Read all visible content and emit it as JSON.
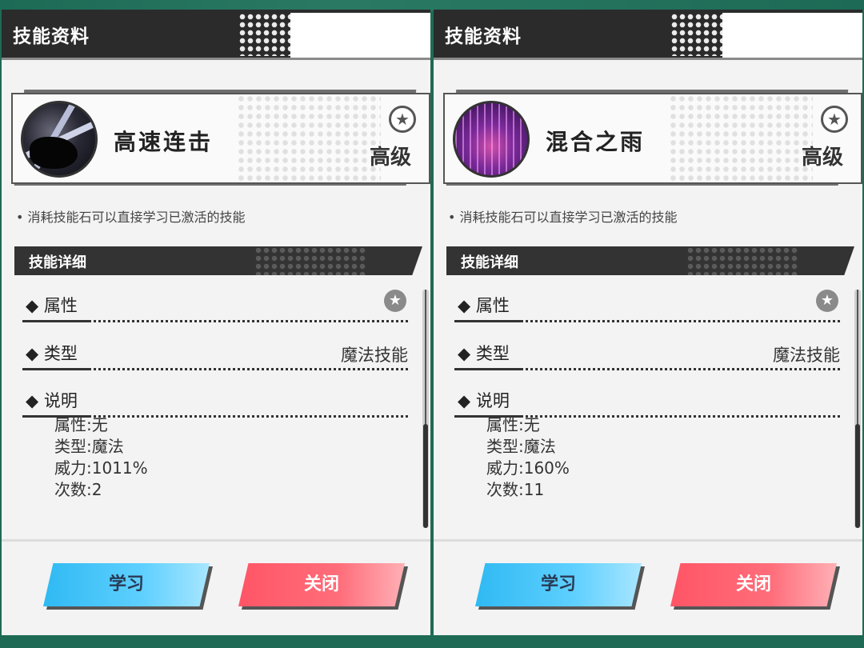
{
  "panels": [
    {
      "window_title": "技能资料",
      "skill_name": "高速连击",
      "rank": "高级",
      "hint": "• 消耗技能石可以直接学习已激活的技能",
      "section_header": "技能详细",
      "rows": {
        "attribute_key": "◆ 属性",
        "type_key": "◆ 类型",
        "type_value": "魔法技能",
        "desc_key": "◆ 说明"
      },
      "description": [
        "属性:无",
        "类型:魔法",
        "威力:1011%",
        "次数:2"
      ],
      "learn_label": "学习",
      "close_label": "关闭"
    },
    {
      "window_title": "技能资料",
      "skill_name": "混合之雨",
      "rank": "高级",
      "hint": "• 消耗技能石可以直接学习已激活的技能",
      "section_header": "技能详细",
      "rows": {
        "attribute_key": "◆ 属性",
        "type_key": "◆ 类型",
        "type_value": "魔法技能",
        "desc_key": "◆ 说明"
      },
      "description": [
        "属性:无",
        "类型:魔法",
        "威力:160%",
        "次数:11"
      ],
      "learn_label": "学习",
      "close_label": "关闭"
    }
  ],
  "icons": {
    "star": "★"
  },
  "colors": {
    "learn_button": "#2fb9f2",
    "close_button": "#ff5566",
    "titlebar": "#2b2b2b"
  }
}
